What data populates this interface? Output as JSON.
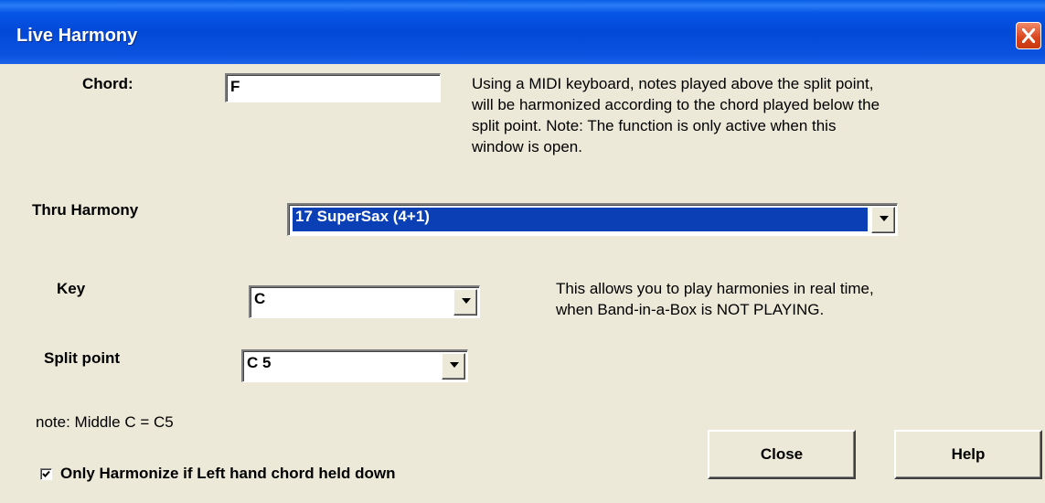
{
  "window": {
    "title": "Live Harmony"
  },
  "chord": {
    "label": "Chord:",
    "value": "F"
  },
  "info_top": [
    "Using a MIDI keyboard, notes played above the split point,",
    "will be harmonized according to the chord played below the",
    "split point. Note: The function is only active when this",
    "window is open."
  ],
  "thru_harmony": {
    "label": "Thru Harmony",
    "value": "17 SuperSax (4+1)"
  },
  "key": {
    "label": "Key",
    "value": "C"
  },
  "info_mid": [
    "This allows you to play harmonies in real time,",
    "when Band-in-a-Box is NOT PLAYING."
  ],
  "split_point": {
    "label": "Split point",
    "value": "C 5"
  },
  "note": "note: Middle C = C5",
  "checkbox": {
    "label": "Only Harmonize if Left hand chord held down",
    "checked": true
  },
  "buttons": {
    "close": "Close",
    "help": "Help"
  },
  "icons": {
    "close": "close-icon",
    "dropdown": "chevron-down-icon",
    "check": "check-icon"
  },
  "colors": {
    "titlebar": "#0349d8",
    "selection": "#0a3fb5",
    "dialog_bg": "#ece9d8",
    "close_button": "#d9431c"
  }
}
